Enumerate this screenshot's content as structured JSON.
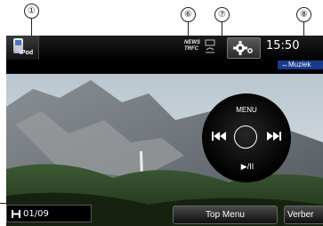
{
  "callouts": [
    {
      "id": "1",
      "label": "①"
    },
    {
      "id": "6",
      "label": "⑥"
    },
    {
      "id": "7",
      "label": "⑦"
    },
    {
      "id": "8",
      "label": "⑧"
    }
  ],
  "header": {
    "source_icon_label": "iPod",
    "news_label": "NEWS",
    "trfc_label": "TRFC",
    "clock": "15:50",
    "source_tab": "↔Muziek"
  },
  "controls": {
    "menu_label": "MENU",
    "prev_icon": "skip-back-icon",
    "next_icon": "skip-forward-icon",
    "play_label": "▶/II"
  },
  "bottom": {
    "chapter": "01/09",
    "top_menu_label": "Top Menu",
    "verber_label": "Verber"
  },
  "colors": {
    "accent_blue": "#173a8a",
    "bar_black": "#000000"
  }
}
